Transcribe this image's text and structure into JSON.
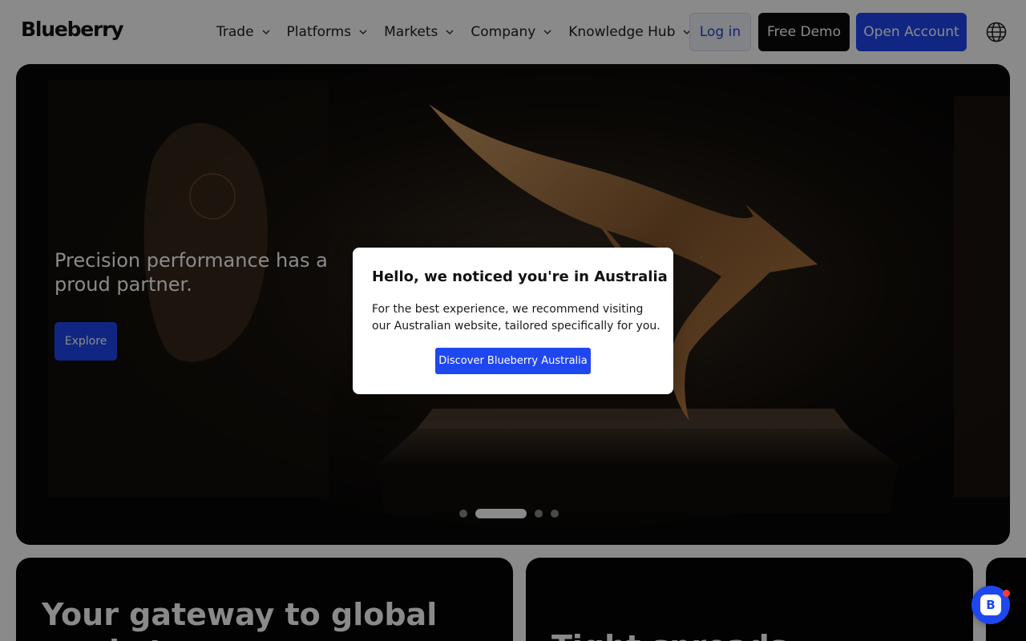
{
  "header": {
    "logo": "Blueberry",
    "nav": [
      {
        "label": "Trade"
      },
      {
        "label": "Platforms"
      },
      {
        "label": "Markets"
      },
      {
        "label": "Company"
      },
      {
        "label": "Knowledge Hub"
      }
    ],
    "login_label": "Log in",
    "demo_label": "Free Demo",
    "open_account_label": "Open Account",
    "language_icon": "globe-icon"
  },
  "hero": {
    "title": "Precision performance has a proud partner.",
    "explore_label": "Explore",
    "slides_count": 4,
    "active_slide": 2
  },
  "cards": [
    {
      "heading": "Your gateway to global markets"
    },
    {
      "heading": "Tight spreads"
    }
  ],
  "modal": {
    "title": "Hello, we noticed you're in Australia",
    "body": "For the best experience, we recommend visiting our Australian website, tailored specifically for you.",
    "button_label": "Discover Blueberry Australia"
  },
  "chat": {
    "icon": "chat-launcher-icon",
    "letter": "B",
    "has_notification": true
  },
  "colors": {
    "brand_blue": "#1f47f0",
    "overlay": "rgba(0,0,0,0.46)"
  }
}
